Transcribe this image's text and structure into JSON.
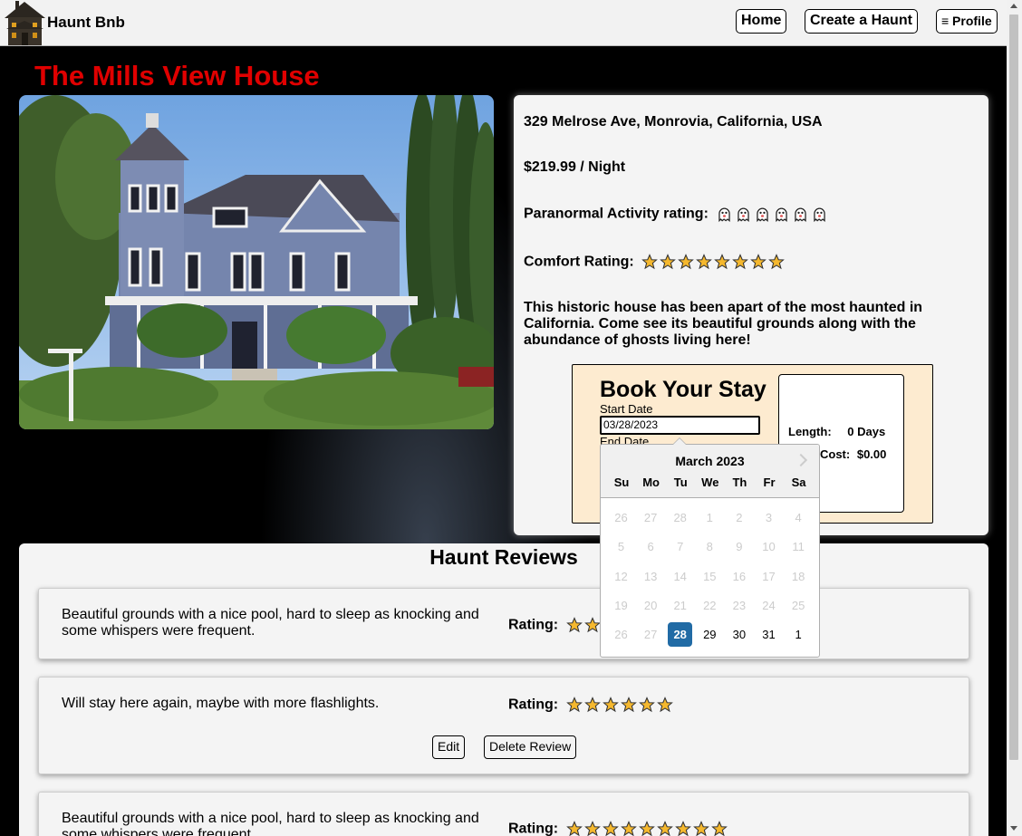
{
  "header": {
    "brand": "Haunt Bnb",
    "nav": {
      "home": "Home",
      "create": "Create a Haunt",
      "profile": "≡ Profile"
    }
  },
  "listing": {
    "title": "The Mills View House",
    "address": "329 Melrose Ave, Monrovia, California, USA",
    "price": "$219.99 / Night",
    "paranormal_label": "Paranormal Activity rating:",
    "paranormal_rating": 6,
    "comfort_label": "Comfort Rating:",
    "comfort_rating": 8,
    "description": "This historic house has been apart of the most haunted in California. Come see its beautiful grounds along with the abundance of ghosts living here!"
  },
  "booking": {
    "title": "Book Your Stay",
    "start_label": "Start Date",
    "start_value": "03/28/2023",
    "end_label": "End Date",
    "length_label": "Length:",
    "length_value": "0 Days",
    "cost_label": "Cost:",
    "cost_value": "$0.00"
  },
  "calendar": {
    "month": "March 2023",
    "day_names": [
      "Su",
      "Mo",
      "Tu",
      "We",
      "Th",
      "Fr",
      "Sa"
    ],
    "weeks": [
      [
        "26",
        "27",
        "28",
        "1",
        "2",
        "3",
        "4"
      ],
      [
        "5",
        "6",
        "7",
        "8",
        "9",
        "10",
        "11"
      ],
      [
        "12",
        "13",
        "14",
        "15",
        "16",
        "17",
        "18"
      ],
      [
        "19",
        "20",
        "21",
        "22",
        "23",
        "24",
        "25"
      ],
      [
        "26",
        "27",
        "28",
        "29",
        "30",
        "31",
        "1"
      ]
    ],
    "enabled": [
      [
        false,
        false,
        false,
        false,
        false,
        false,
        false
      ],
      [
        false,
        false,
        false,
        false,
        false,
        false,
        false
      ],
      [
        false,
        false,
        false,
        false,
        false,
        false,
        false
      ],
      [
        false,
        false,
        false,
        false,
        false,
        false,
        false
      ],
      [
        false,
        false,
        true,
        true,
        true,
        true,
        true
      ]
    ],
    "selected": [
      4,
      2
    ]
  },
  "reviews": {
    "title": "Haunt Reviews",
    "rating_label": "Rating:",
    "items": [
      {
        "text": "Beautiful grounds with a nice pool, hard to sleep as knocking and some whispers were frequent.",
        "rating": 2
      },
      {
        "text": "Will stay here again, maybe with more flashlights.",
        "rating": 6,
        "edit": "Edit",
        "delete": "Delete Review"
      },
      {
        "text": "Beautiful grounds with a nice pool, hard to sleep as knocking and some whispers were frequent.",
        "rating": 9
      }
    ]
  },
  "colors": {
    "title_red": "#e00000",
    "booking_bg": "#fdebd0",
    "selected_day": "#216ba5",
    "star": "#f5b82e"
  }
}
